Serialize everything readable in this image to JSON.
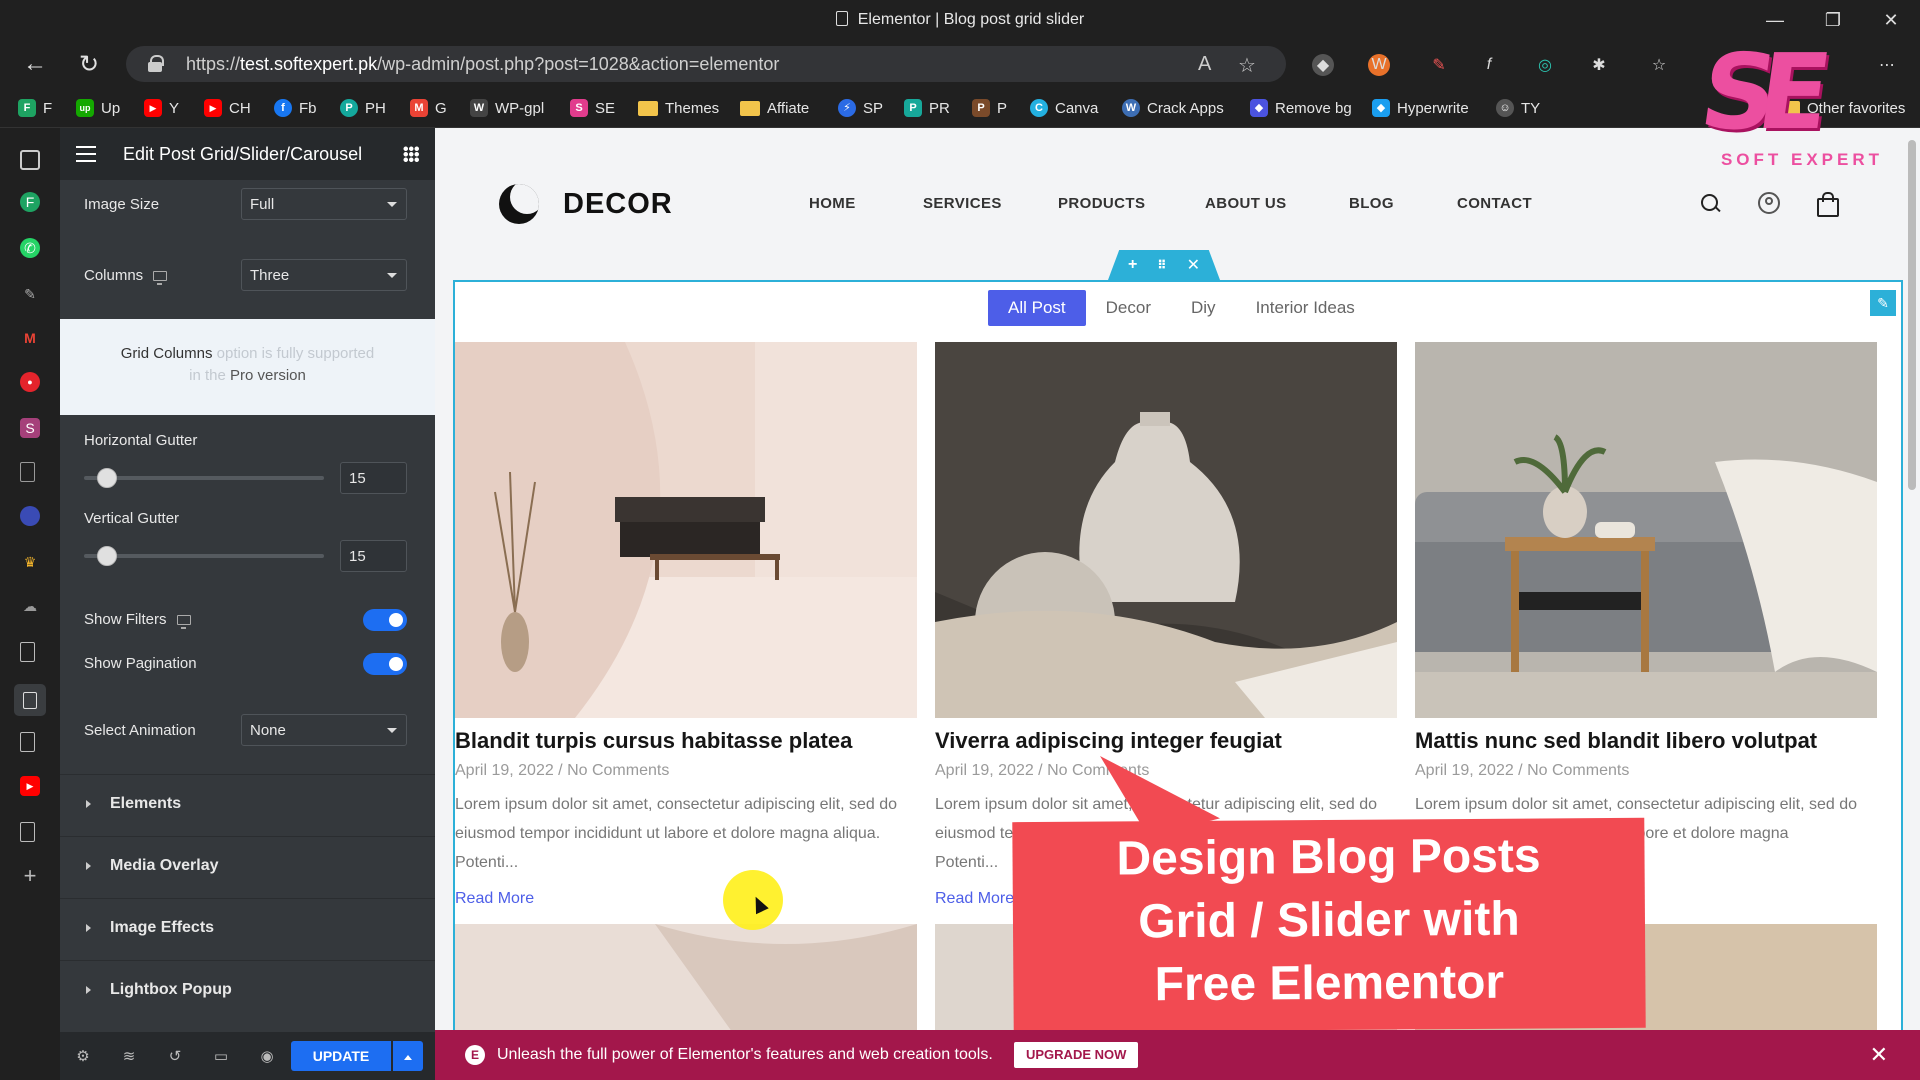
{
  "browser": {
    "title": "Elementor | Blog post grid slider",
    "url_prefix": "https://",
    "url_host": "test.softexpert.pk",
    "url_path": "/wp-admin/post.php?post=1028&action=elementor",
    "window_controls": [
      "—",
      "❐",
      "✕"
    ],
    "bookmarks": [
      {
        "label": "F",
        "icon": "F",
        "color": "#1ea362"
      },
      {
        "label": "Up",
        "icon": "up",
        "color": "#14a800"
      },
      {
        "label": "Y",
        "icon": "▶",
        "color": "#ff0000"
      },
      {
        "label": "CH",
        "icon": "▶",
        "color": "#ff0000"
      },
      {
        "label": "Fb",
        "icon": "f",
        "color": "#1877f2"
      },
      {
        "label": "PH",
        "icon": "P",
        "color": "#14a89c"
      },
      {
        "label": "G",
        "icon": "M",
        "color": "#ea4335"
      },
      {
        "label": "WP-gpl",
        "icon": "W",
        "color": "#444"
      },
      {
        "label": "SE",
        "icon": "S",
        "color": "#e13c8d"
      },
      {
        "label": "Themes",
        "icon": "",
        "color": "folder"
      },
      {
        "label": "Affiate",
        "icon": "",
        "color": "folder"
      },
      {
        "label": "SP",
        "icon": "⚡",
        "color": "#2b6be5"
      },
      {
        "label": "PR",
        "icon": "P",
        "color": "#17a89a"
      },
      {
        "label": "P",
        "icon": "P",
        "color": "#7a4a2a"
      },
      {
        "label": "Canva",
        "icon": "C",
        "color": "#23b0e0"
      },
      {
        "label": "Crack Apps",
        "icon": "W",
        "color": "#3d6eb4"
      },
      {
        "label": "Remove bg",
        "icon": "◆",
        "color": "#4b53e0"
      },
      {
        "label": "Hyperwrite",
        "icon": "◆",
        "color": "#1a9ef0"
      },
      {
        "label": "TY",
        "icon": "☺",
        "color": "#555"
      }
    ],
    "other_favorites": "Other favorites"
  },
  "overlay_logo": {
    "mark": "SE",
    "word": "SOFT EXPERT"
  },
  "panel": {
    "title": "Edit Post Grid/Slider/Carousel",
    "image_size": {
      "label": "Image Size",
      "value": "Full"
    },
    "columns": {
      "label": "Columns",
      "value": "Three"
    },
    "pro_notice": {
      "lead": "Grid Columns",
      "faint1": " option is fully supported",
      "faint2": "in the ",
      "pro": "Pro version"
    },
    "horizontal_gutter": {
      "label": "Horizontal Gutter",
      "value": "15",
      "level": 0.06
    },
    "vertical_gutter": {
      "label": "Vertical Gutter",
      "value": "15",
      "level": 0.06
    },
    "show_filters": {
      "label": "Show Filters",
      "on": true
    },
    "show_pagination": {
      "label": "Show Pagination",
      "on": true
    },
    "select_animation": {
      "label": "Select Animation",
      "value": "None"
    },
    "sections": [
      "Elements",
      "Media Overlay",
      "Image Effects",
      "Lightbox Popup"
    ],
    "update_label": "UPDATE"
  },
  "site": {
    "logo": "DECOR",
    "nav": [
      "HOME",
      "SERVICES",
      "PRODUCTS",
      "ABOUT US",
      "BLOG",
      "CONTACT"
    ],
    "filters": [
      "All Post",
      "Decor",
      "Diy",
      "Interior Ideas"
    ],
    "posts": [
      {
        "title": "Blandit turpis cursus habitasse platea",
        "date": "April 19, 2022",
        "comments": "No Comments",
        "excerpt": "Lorem ipsum dolor sit amet, consectetur adipiscing elit, sed do eiusmod tempor incididunt ut labore et dolore magna aliqua. Potenti...",
        "read_more": "Read More"
      },
      {
        "title": "Viverra adipiscing integer feugiat",
        "date": "April 19, 2022",
        "comments": "No Comments",
        "excerpt": "Lorem ipsum dolor sit amet, consectetur adipiscing elit, sed do eiusmod tempor incididunt ut labore et dolore magna aliqua. Potenti...",
        "read_more": "Read More"
      },
      {
        "title": "Mattis nunc sed blandit libero volutpat",
        "date": "April 19, 2022",
        "comments": "No Comments",
        "excerpt": "Lorem ipsum dolor sit amet, consectetur adipiscing elit, sed do eiusmod tempor incididunt ut labore et dolore magna",
        "read_more": ""
      }
    ]
  },
  "promo": {
    "line1": "Design Blog Posts",
    "line2": "Grid / Slider with",
    "line3": "Free Elementor"
  },
  "notice": {
    "message": "Unleash the full power of Elementor's features and web creation tools.",
    "button": "UPGRADE NOW"
  },
  "colors": {
    "accent": "#4d5ee8",
    "elementor_blue": "#1d6ef2",
    "notice_bg": "#a3174b",
    "promo_red": "#f24a52",
    "handle_cyan": "#2cb0d8"
  }
}
